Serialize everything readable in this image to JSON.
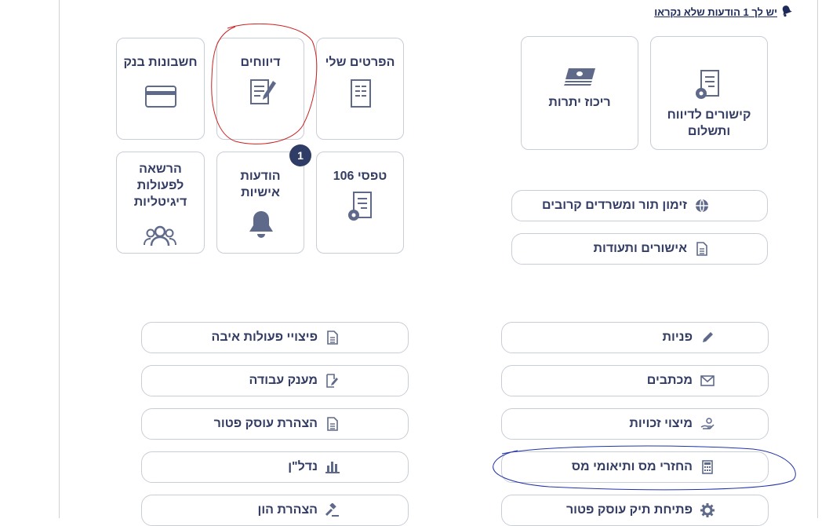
{
  "notification": {
    "text": "יש לך 1 הודעות שלא נקראו",
    "icon": "bell-icon"
  },
  "tiles": {
    "bank_accounts": "חשבונות בנק",
    "reports": "דיווחים",
    "my_details": "הפרטים שלי",
    "digital_permission": "הרשאה לפעולות דיגיטליות",
    "personal_messages": "הודעות אישיות",
    "personal_messages_badge": "1",
    "forms_106": "טפסי 106",
    "balances": "ריכוז יתרות",
    "payment_links": "קישורים לדיווח ותשלום"
  },
  "side_links": {
    "appointments": "זימון תור ומשרדים קרובים",
    "certificates": "אישורים ותעודות"
  },
  "left_links": [
    {
      "label": "פיצויי פעולות איבה",
      "icon": "document-icon"
    },
    {
      "label": "מענק עבודה",
      "icon": "edit-document-icon"
    },
    {
      "label": "הצהרת עוסק פטור",
      "icon": "document-icon"
    },
    {
      "label": "נדל\"ן",
      "icon": "bar-chart-icon"
    },
    {
      "label": "הצהרת הון",
      "icon": "gavel-icon"
    }
  ],
  "right_links": [
    {
      "label": "פניות",
      "icon": "pencil-icon"
    },
    {
      "label": "מכתבים",
      "icon": "envelope-icon"
    },
    {
      "label": "מיצוי זכויות",
      "icon": "hand-coin-icon"
    },
    {
      "label": "החזרי מס ותיאומי מס",
      "icon": "calculator-icon"
    },
    {
      "label": "פתיחת תיק עוסק פטור",
      "icon": "gear-icon"
    }
  ],
  "colors": {
    "text": "#333c63",
    "border": "#c9cdd6",
    "icon": "#5f6a8a",
    "badge": "#2f3d66",
    "red_annotation": "#cc2222",
    "blue_annotation": "#2233aa"
  }
}
